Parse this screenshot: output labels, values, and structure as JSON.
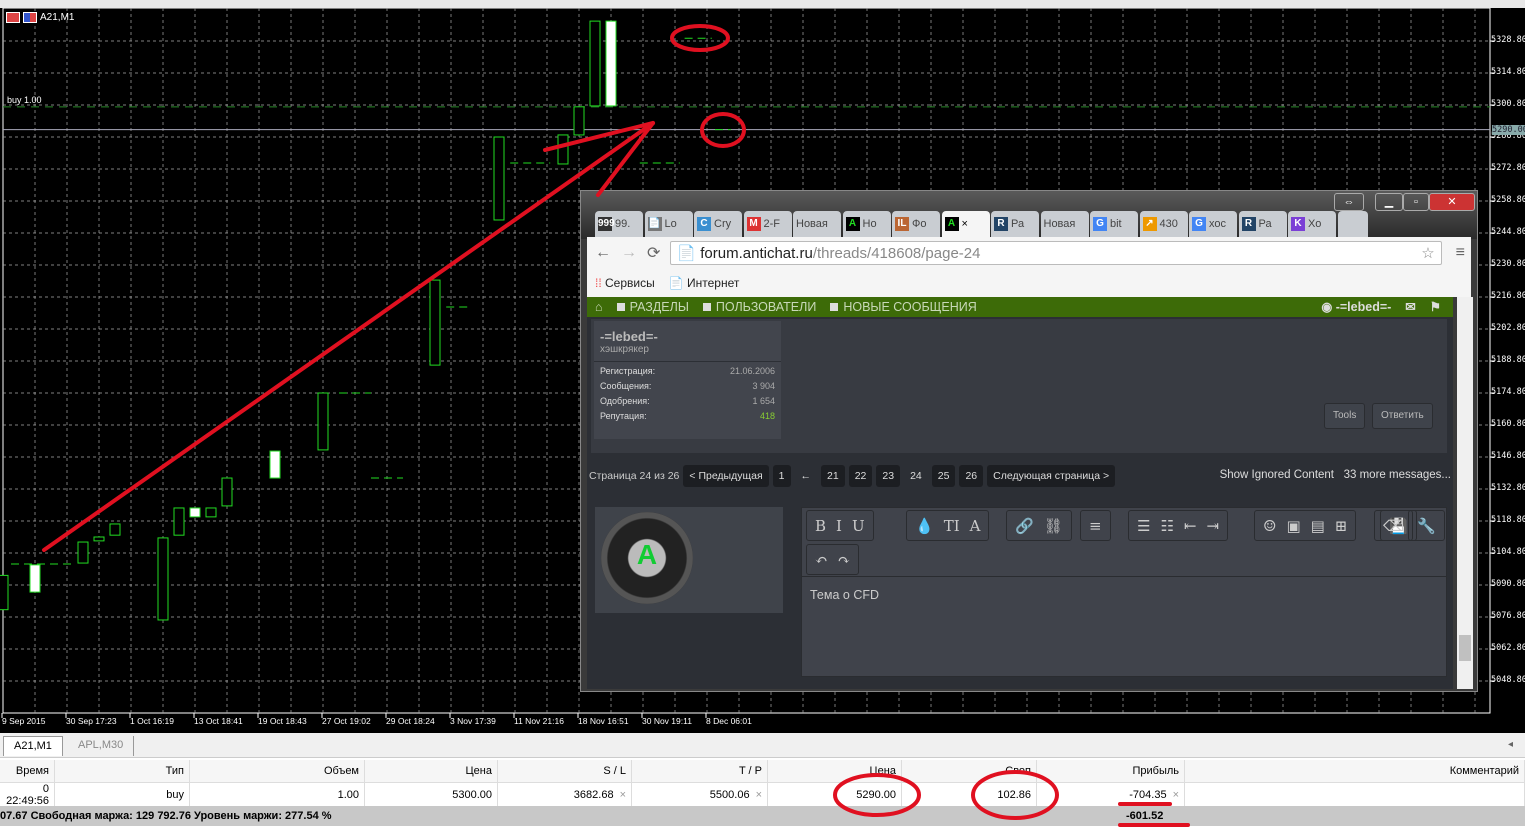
{
  "chart": {
    "symbol": "A21,M1",
    "order_label": "buy 1.00",
    "current_price_label": "5290.00",
    "price_labels": [
      "5328.80",
      "5314.80",
      "5300.80",
      "5286.80",
      "5272.80",
      "5258.80",
      "5244.80",
      "5230.80",
      "5216.80",
      "5202.80",
      "5188.80",
      "5174.80",
      "5160.80",
      "5146.80",
      "5132.80",
      "5118.80",
      "5104.80",
      "5090.80",
      "5076.80",
      "5062.80",
      "5048.80"
    ],
    "time_labels": [
      "9 Sep 2015",
      "30 Sep 17:23",
      "1 Oct 16:19",
      "13 Oct 18:41",
      "19 Oct 18:43",
      "27 Oct 19:02",
      "29 Oct 18:24",
      "3 Nov 17:39",
      "11 Nov 21:16",
      "18 Nov 16:51",
      "30 Nov 19:11",
      "8 Dec 06:01"
    ],
    "colors": {
      "bg": "#000000",
      "candle": "#22dd22",
      "grid": "#c0c0c0",
      "order_line": "#2a8a2a",
      "annotation": "#e01020"
    }
  },
  "chart_data": {
    "type": "candlestick",
    "title": "A21,M1",
    "ylim": [
      5042.0,
      5340.0
    ],
    "order_line": 5300.0,
    "current_price": 5290.0,
    "candles": [
      {
        "bar": 0,
        "low": 5080,
        "high": 5095,
        "hollow": true
      },
      {
        "bar": 2,
        "low": 5087.7,
        "high": 5099.6,
        "hollow": false
      },
      {
        "bar": 5,
        "low": 5100.4,
        "high": 5109.6,
        "hollow": true
      },
      {
        "bar": 6,
        "low": 5110.1,
        "high": 5111.8,
        "hollow": true
      },
      {
        "bar": 7,
        "low": 5112.6,
        "high": 5117.5,
        "hollow": true
      },
      {
        "bar": 10,
        "low": 5075.5,
        "high": 5111.4,
        "hollow": true
      },
      {
        "bar": 11,
        "low": 5112.6,
        "high": 5124.5,
        "hollow": true
      },
      {
        "bar": 12,
        "low": 5120.6,
        "high": 5124.5,
        "hollow": false
      },
      {
        "bar": 13,
        "low": 5120.6,
        "high": 5124.5,
        "hollow": true
      },
      {
        "bar": 14,
        "low": 5125.4,
        "high": 5137.6,
        "hollow": true
      },
      {
        "bar": 17,
        "low": 5137.6,
        "high": 5149.4,
        "hollow": false
      },
      {
        "bar": 20,
        "low": 5149.9,
        "high": 5174.8,
        "hollow": true
      },
      {
        "bar": 27,
        "low": 5187.0,
        "high": 5224.2,
        "hollow": true
      },
      {
        "bar": 31,
        "low": 5250.5,
        "high": 5286.8,
        "hollow": true
      },
      {
        "bar": 35,
        "low": 5275.0,
        "high": 5287.7,
        "hollow": true
      },
      {
        "bar": 36,
        "low": 5287.7,
        "high": 5300.0,
        "hollow": true
      },
      {
        "bar": 37,
        "low": 5300.4,
        "high": 5337.5,
        "hollow": true
      },
      {
        "bar": 38,
        "low": 5300.4,
        "high": 5337.5,
        "hollow": false
      }
    ],
    "flat_bars": [
      {
        "from": 0.5,
        "to": 4.5,
        "price": 5100.0
      },
      {
        "from": 21,
        "to": 23,
        "price": 5174.8
      },
      {
        "from": 23,
        "to": 25,
        "price": 5137.6
      },
      {
        "from": 27.7,
        "to": 29.3,
        "price": 5212.4
      },
      {
        "from": 31.7,
        "to": 34.2,
        "price": 5275.4
      },
      {
        "from": 39.8,
        "to": 42.3,
        "price": 5275.4
      },
      {
        "from": 42.6,
        "to": 44.3,
        "price": 5330.0
      },
      {
        "from": 44.5,
        "to": 45.5,
        "price": 5290.0
      }
    ]
  },
  "chart_tabs": [
    "A21,M1",
    "APL,M30"
  ],
  "table": {
    "headers": [
      "Время",
      "Тип",
      "Объем",
      "Цена",
      "S / L",
      "T / P",
      "Цена",
      "Своп",
      "Прибыль",
      "Комментарий"
    ],
    "row": [
      "0 22:49:56",
      "buy",
      "1.00",
      "5300.00",
      "3682.68",
      "5500.06",
      "5290.00",
      "102.86",
      "-704.35",
      ""
    ],
    "summary": "07.67  Свободная маржа: 129 792.76  Уровень маржи: 277.54 %",
    "summary_profit": "-601.52",
    "close_glyph": "×"
  },
  "browser": {
    "tabs": [
      {
        "icon": "999",
        "label": "99."
      },
      {
        "icon": "📄",
        "label": "Lo"
      },
      {
        "icon": "C",
        "label": "Cry"
      },
      {
        "icon": "M",
        "label": "2-F"
      },
      {
        "icon": "",
        "label": "Новая"
      },
      {
        "icon": "A",
        "label": "Ho"
      },
      {
        "icon": "IL",
        "label": "Фо"
      },
      {
        "icon": "A",
        "label": "×"
      },
      {
        "icon": "R",
        "label": "Ра"
      },
      {
        "icon": "",
        "label": "Новая"
      },
      {
        "icon": "G",
        "label": "bit"
      },
      {
        "icon": "↗",
        "label": "430"
      },
      {
        "icon": "G",
        "label": "хос"
      },
      {
        "icon": "R",
        "label": "Ра"
      },
      {
        "icon": "K",
        "label": "Хо"
      }
    ],
    "url_host": "forum.antichat.ru",
    "url_path": "/threads/418608/page-24",
    "bookmarks": [
      "Сервисы",
      "Интернет"
    ],
    "nav": [
      "РАЗДЕЛЫ",
      "ПОЛЬЗОВАТЕЛИ",
      "НОВЫЕ СООБЩЕНИЯ"
    ],
    "username": "-=lebed=-",
    "user_title": "хэшкрякер",
    "stats": [
      {
        "label": "Регистрация:",
        "value": "21.06.2006"
      },
      {
        "label": "Сообщения:",
        "value": "3 904"
      },
      {
        "label": "Одобрения:",
        "value": "1 654"
      },
      {
        "label": "Репутация:",
        "value": "418"
      }
    ],
    "post_buttons": [
      "Tools",
      "Ответить"
    ],
    "page_info": "Страница 24 из 26",
    "prev": "< Предыдущая",
    "pages": [
      "1",
      "←",
      "21",
      "22",
      "23",
      "24",
      "25",
      "26"
    ],
    "next": "Следующая страница >",
    "show_ignored": "Show Ignored Content",
    "more_messages": "33 more messages...",
    "avatar_letter": "A",
    "editor_text": "Тема о CFD",
    "toolbar_groups": [
      [
        "B",
        "I",
        "U"
      ],
      [
        "💧",
        "TI",
        "A"
      ],
      [
        "🔗",
        "⛓"
      ],
      [
        "≡"
      ],
      [
        "☰",
        "☷",
        "⇤",
        "⇥"
      ],
      [
        "☺",
        "▣",
        "▤",
        "⊞"
      ],
      [
        "💾"
      ]
    ],
    "toolbar_right": [
      "⌫",
      "🔧"
    ],
    "undo_redo": [
      "↶",
      "↷"
    ]
  }
}
